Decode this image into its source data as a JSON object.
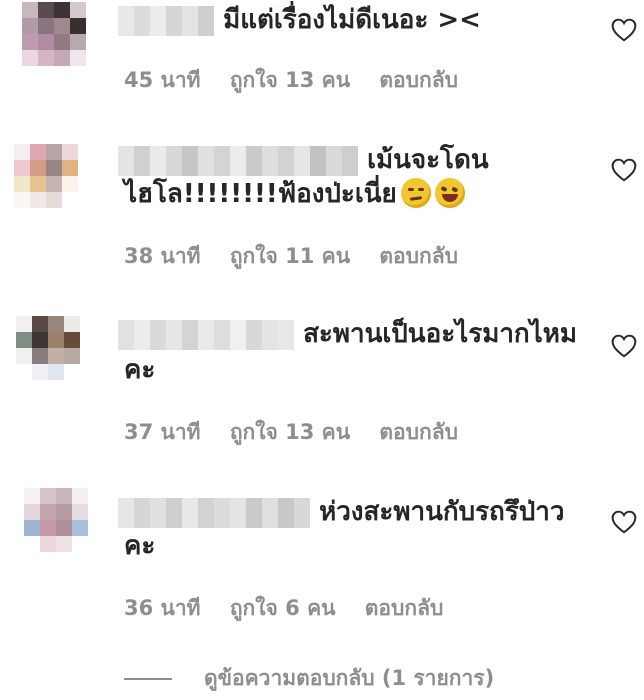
{
  "comments": [
    {
      "text_lines": [
        "มีแต่เรื่องไม่ดีเนอะ ><"
      ],
      "time": "45 นาที",
      "likes": "ถูกใจ 13 คน",
      "reply": "ตอบกลับ"
    },
    {
      "text_lines": [
        "เม้นจะโดน",
        "ไฮโล!!!!!!!!ฟ้องป่ะเนี่ย"
      ],
      "emojis": [
        "smirking-face",
        "grinning-squinting-face"
      ],
      "time": "38 นาที",
      "likes": "ถูกใจ 11 คน",
      "reply": "ตอบกลับ"
    },
    {
      "text_lines": [
        "สะพานเป็นอะไรมากไหม",
        "คะ"
      ],
      "time": "37 นาที",
      "likes": "ถูกใจ 13 คน",
      "reply": "ตอบกลับ"
    },
    {
      "text_lines": [
        "ห่วงสะพานกับรถรึป่าว",
        "คะ"
      ],
      "time": "36 นาที",
      "likes": "ถูกใจ 6 คน",
      "reply": "ตอบกลับ"
    }
  ],
  "view_replies": "ดูข้อความตอบกลับ (1 รายการ)",
  "colors": {
    "text": "#262626",
    "meta": "#8e8e8e",
    "background": "#ffffff"
  }
}
